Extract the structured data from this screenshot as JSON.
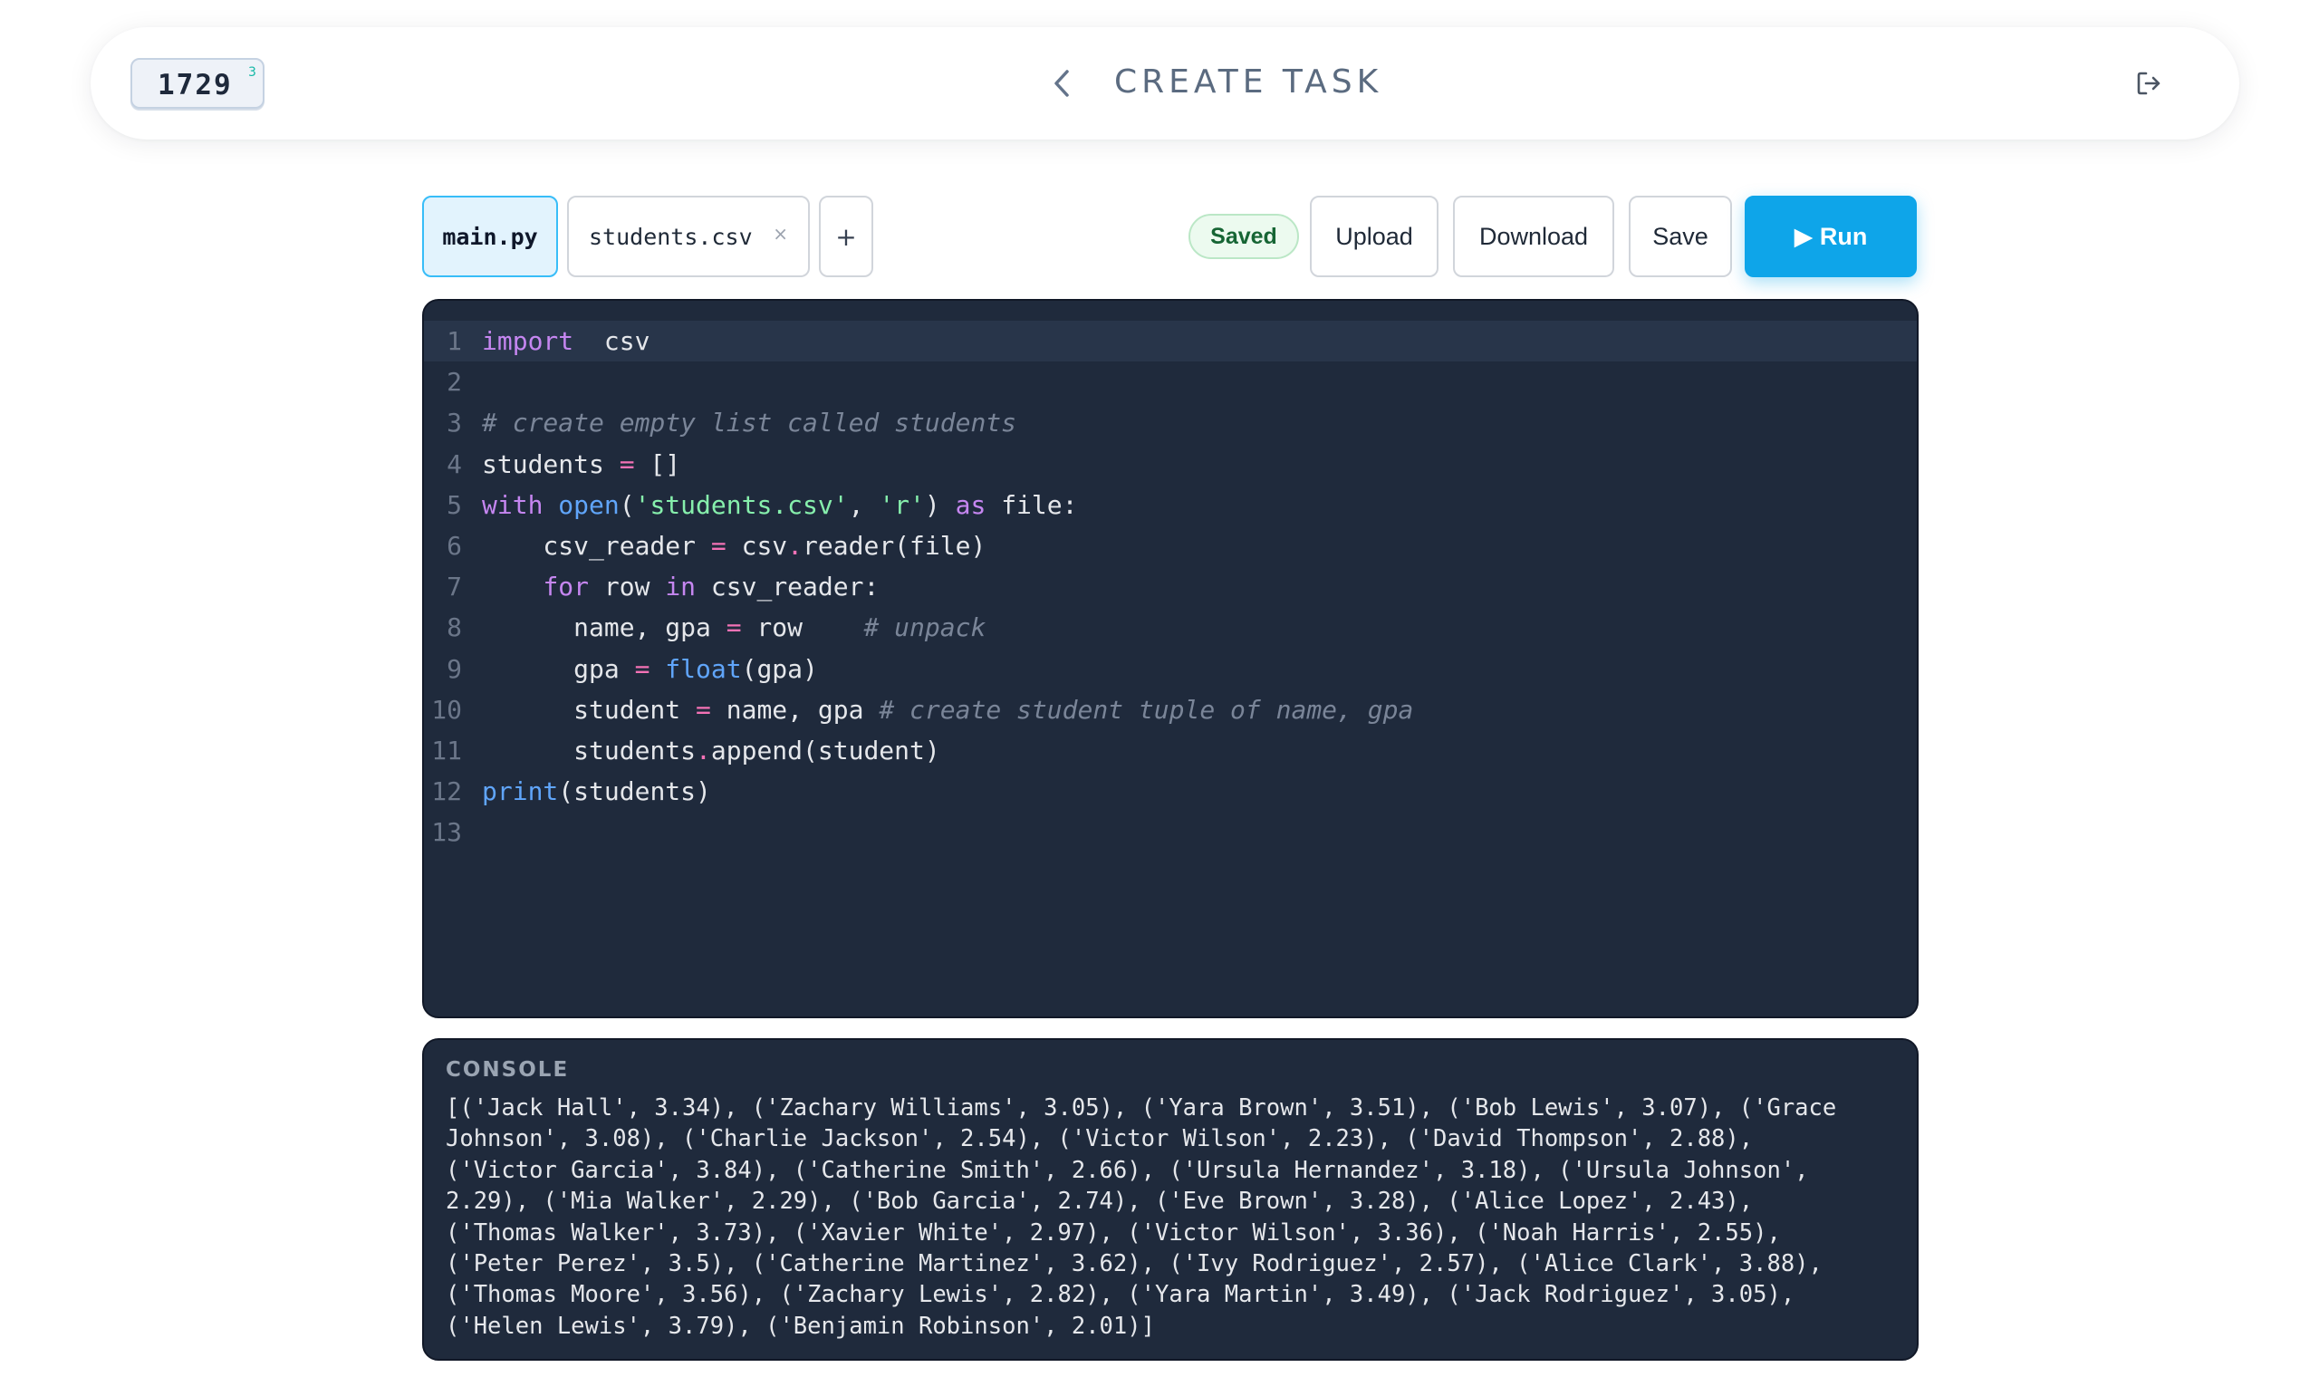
{
  "header": {
    "counter": "1729",
    "counter_sup": "3",
    "title": "CREATE TASK",
    "back_icon": "chevron-left-icon",
    "logout_icon": "logout-icon"
  },
  "tabs": [
    {
      "label": "main.py",
      "active": true
    },
    {
      "label": "students.csv",
      "active": false,
      "close": "×"
    }
  ],
  "add_tab_label": "+",
  "status": "Saved",
  "buttons": {
    "upload": "Upload",
    "download": "Download",
    "save": "Save",
    "run": "▶ Run"
  },
  "editor": {
    "active_line": 1,
    "lines": [
      {
        "n": "1",
        "tokens": [
          [
            "kw",
            "import"
          ],
          [
            "",
            "  csv"
          ]
        ]
      },
      {
        "n": "2",
        "tokens": []
      },
      {
        "n": "3",
        "tokens": [
          [
            "cm",
            "# create empty list called students"
          ]
        ]
      },
      {
        "n": "4",
        "tokens": [
          [
            "",
            "students "
          ],
          [
            "op",
            "="
          ],
          [
            "",
            " []"
          ]
        ]
      },
      {
        "n": "5",
        "tokens": [
          [
            "kw",
            "with"
          ],
          [
            "",
            " "
          ],
          [
            "bi",
            "open"
          ],
          [
            "",
            "("
          ],
          [
            "str",
            "'students.csv'"
          ],
          [
            "",
            ", "
          ],
          [
            "str",
            "'r'"
          ],
          [
            "",
            ") "
          ],
          [
            "kw",
            "as"
          ],
          [
            "",
            " file:"
          ]
        ]
      },
      {
        "n": "6",
        "tokens": [
          [
            "",
            "    csv_reader "
          ],
          [
            "op",
            "="
          ],
          [
            "",
            " csv"
          ],
          [
            "op",
            "."
          ],
          [
            "",
            "reader(file)"
          ]
        ]
      },
      {
        "n": "7",
        "tokens": [
          [
            "",
            "    "
          ],
          [
            "kw",
            "for"
          ],
          [
            "",
            " row "
          ],
          [
            "kw",
            "in"
          ],
          [
            "",
            " csv_reader:"
          ]
        ]
      },
      {
        "n": "8",
        "tokens": [
          [
            "",
            "      name, gpa "
          ],
          [
            "op",
            "="
          ],
          [
            "",
            " row    "
          ],
          [
            "cm",
            "# unpack"
          ]
        ]
      },
      {
        "n": "9",
        "tokens": [
          [
            "",
            "      gpa "
          ],
          [
            "op",
            "="
          ],
          [
            "",
            " "
          ],
          [
            "bi",
            "float"
          ],
          [
            "",
            "(gpa)"
          ]
        ]
      },
      {
        "n": "10",
        "tokens": [
          [
            "",
            "      student "
          ],
          [
            "op",
            "="
          ],
          [
            "",
            " name, gpa "
          ],
          [
            "cm",
            "# create student tuple of name, gpa"
          ]
        ]
      },
      {
        "n": "11",
        "tokens": [
          [
            "",
            "      students"
          ],
          [
            "op",
            "."
          ],
          [
            "",
            "append(student)"
          ]
        ]
      },
      {
        "n": "12",
        "tokens": [
          [
            "bi",
            "print"
          ],
          [
            "",
            "(students)"
          ]
        ]
      },
      {
        "n": "13",
        "tokens": []
      }
    ]
  },
  "console": {
    "label": "CONSOLE",
    "lines": [
      "[('Jack Hall', 3.34), ('Zachary Williams', 3.05), ('Yara Brown', 3.51), ('Bob Lewis', 3.07), ('Grace",
      "Johnson', 3.08), ('Charlie Jackson', 2.54), ('Victor Wilson', 2.23), ('David Thompson', 2.88),",
      "('Victor Garcia', 3.84), ('Catherine Smith', 2.66), ('Ursula Hernandez', 3.18), ('Ursula Johnson',",
      "2.29), ('Mia Walker', 2.29), ('Bob Garcia', 2.74), ('Eve Brown', 3.28), ('Alice Lopez', 2.43),",
      "('Thomas Walker', 3.73), ('Xavier White', 2.97), ('Victor Wilson', 3.36), ('Noah Harris', 2.55),",
      "('Peter Perez', 3.5), ('Catherine Martinez', 3.62), ('Ivy Rodriguez', 2.57), ('Alice Clark', 3.88),",
      "('Thomas Moore', 3.56), ('Zachary Lewis', 2.82), ('Yara Martin', 3.49), ('Jack Rodriguez', 3.05),",
      "('Helen Lewis', 3.79), ('Benjamin Robinson', 2.01)]"
    ]
  }
}
